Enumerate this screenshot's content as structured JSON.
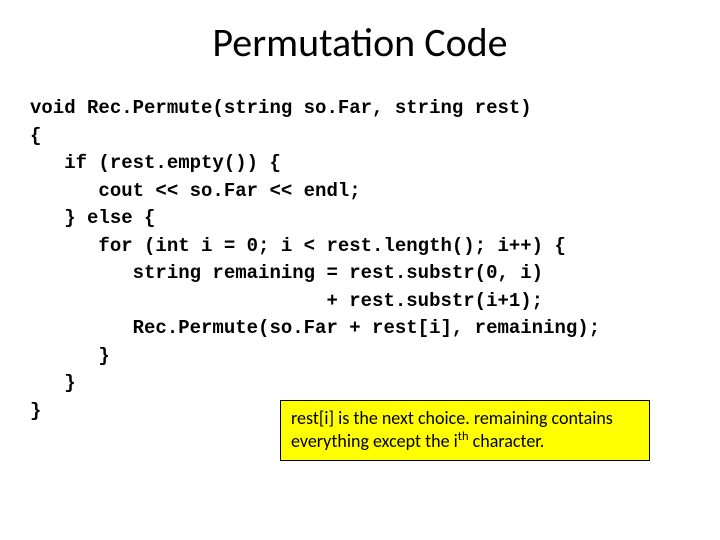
{
  "title": "Permutation Code",
  "code": {
    "l1": "void Rec.Permute(string so.Far, string rest)",
    "l2": "{",
    "l3": "   if (rest.empty()) {",
    "l4": "      cout << so.Far << endl;",
    "l5": "   } else {",
    "l6": "      for (int i = 0; i < rest.length(); i++) {",
    "l7": "         string remaining = rest.substr(0, i)",
    "l8": "                          + rest.substr(i+1);",
    "l9": "         Rec.Permute(so.Far + rest[i], remaining);",
    "l10": "      }",
    "l11": "   }",
    "l12": "}"
  },
  "note": {
    "part1": "rest[i] is the next choice.  remaining contains everything except the i",
    "sup": "th",
    "part2": " character."
  }
}
